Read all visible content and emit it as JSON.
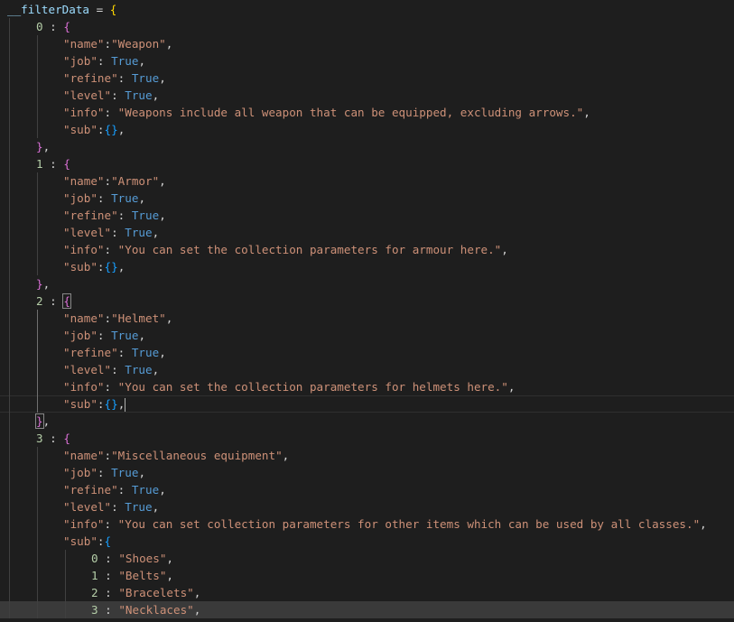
{
  "editor": {
    "root": {
      "variable": "__filterData",
      "assign": " = ",
      "open_brace": "{"
    },
    "separator": " : ",
    "entries": [
      {
        "key": "0",
        "name": "\"Weapon\"",
        "job": "True",
        "refine": "True",
        "level": "True",
        "info": "\"Weapons include all weapon that can be equipped, excluding arrows.\"",
        "sub": "{}"
      },
      {
        "key": "1",
        "name": "\"Armor\"",
        "job": "True",
        "refine": "True",
        "level": "True",
        "info": "\"You can set the collection parameters for armour here.\"",
        "sub": "{}"
      },
      {
        "key": "2",
        "name": "\"Helmet\"",
        "job": "True",
        "refine": "True",
        "level": "True",
        "info": "\"You can set the collection parameters for helmets here.\"",
        "sub": "{}"
      },
      {
        "key": "3",
        "name": "\"Miscellaneous equipment\"",
        "job": "True",
        "refine": "True",
        "level": "True",
        "info": "\"You can set collection parameters for other items which can be used by all classes.\"",
        "sub_items": [
          {
            "key": "0",
            "value": "\"Shoes\""
          },
          {
            "key": "1",
            "value": "\"Belts\""
          },
          {
            "key": "2",
            "value": "\"Bracelets\""
          },
          {
            "key": "3",
            "value": "\"Necklaces\""
          }
        ]
      }
    ],
    "keys": {
      "name": "\"name\"",
      "job": "\"job\"",
      "refine": "\"refine\"",
      "level": "\"level\"",
      "info": "\"info\"",
      "sub": "\"sub\""
    },
    "colors": {
      "background": "#1e1e1e",
      "string": "#ce9178",
      "keyword": "#569cd6",
      "number": "#b5cea8",
      "variable": "#9cdcfe",
      "bracket_level1": "#ffd700",
      "bracket_level2": "#da70d6",
      "bracket_level3": "#179fff"
    }
  }
}
